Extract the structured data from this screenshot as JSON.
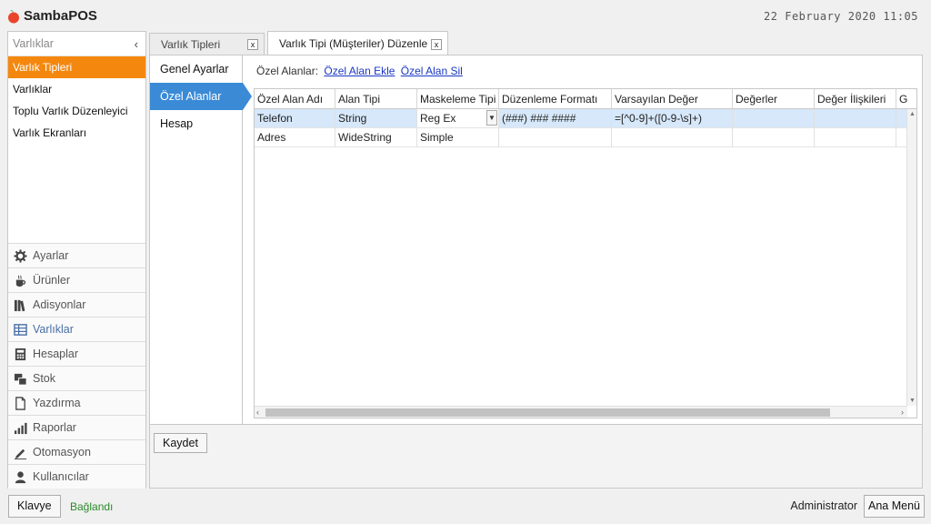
{
  "app": {
    "name": "SambaPOS",
    "datetime": "22 February 2020 11:05"
  },
  "sidebar": {
    "header": "Varlıklar",
    "collapse_glyph": "‹",
    "items": [
      {
        "label": "Varlık Tipleri",
        "active": true
      },
      {
        "label": "Varlıklar",
        "active": false
      },
      {
        "label": "Toplu Varlık Düzenleyici",
        "active": false
      },
      {
        "label": "Varlık Ekranları",
        "active": false
      }
    ]
  },
  "nav": {
    "items": [
      {
        "label": "Ayarlar",
        "icon": "gear-icon"
      },
      {
        "label": "Ürünler",
        "icon": "coffee-cup-icon"
      },
      {
        "label": "Adisyonlar",
        "icon": "books-icon"
      },
      {
        "label": "Varlıklar",
        "icon": "table-grid-icon",
        "active": true
      },
      {
        "label": "Hesaplar",
        "icon": "calculator-icon"
      },
      {
        "label": "Stok",
        "icon": "stack-icon"
      },
      {
        "label": "Yazdırma",
        "icon": "document-icon"
      },
      {
        "label": "Raporlar",
        "icon": "bar-chart-icon"
      },
      {
        "label": "Otomasyon",
        "icon": "pen-icon"
      },
      {
        "label": "Kullanıcılar",
        "icon": "user-icon"
      }
    ]
  },
  "tabs": [
    {
      "label": "Varlık Tipleri",
      "close": "x",
      "active": false
    },
    {
      "label": "Varlık Tipi (Müşteriler) Düzenle",
      "close": "x",
      "active": true
    }
  ],
  "sub_nav": [
    {
      "label": "Genel Ayarlar",
      "active": false
    },
    {
      "label": "Özel Alanlar",
      "active": true
    },
    {
      "label": "Hesap",
      "active": false
    }
  ],
  "custom_fields": {
    "label": "Özel Alanlar:",
    "add_link": "Özel Alan Ekle",
    "delete_link": "Özel Alan Sil"
  },
  "grid": {
    "columns": [
      "Özel Alan Adı",
      "Alan Tipi",
      "Maskeleme Tipi",
      "Düzenleme Formatı",
      "Varsayılan Değer",
      "Değerler",
      "Değer İlişkileri",
      "G"
    ],
    "rows": [
      {
        "cells": [
          "Telefon",
          "String",
          "Reg Ex",
          "(###) ### ####",
          "=[^0-9]+([0-9-\\s]+)",
          "",
          "",
          ""
        ],
        "selected": true
      },
      {
        "cells": [
          "Adres",
          "WideString",
          "Simple",
          "",
          "",
          "",
          "",
          ""
        ],
        "selected": false
      }
    ]
  },
  "actions": {
    "save_label": "Kaydet"
  },
  "status": {
    "keyboard_label": "Klavye",
    "connection": "Bağlandı",
    "user": "Administrator",
    "main_menu_label": "Ana Menü"
  },
  "colors": {
    "accent": "#f4880f",
    "selection": "#3a8ad6",
    "connected": "#2a8a2a",
    "link": "#1a38c4"
  }
}
